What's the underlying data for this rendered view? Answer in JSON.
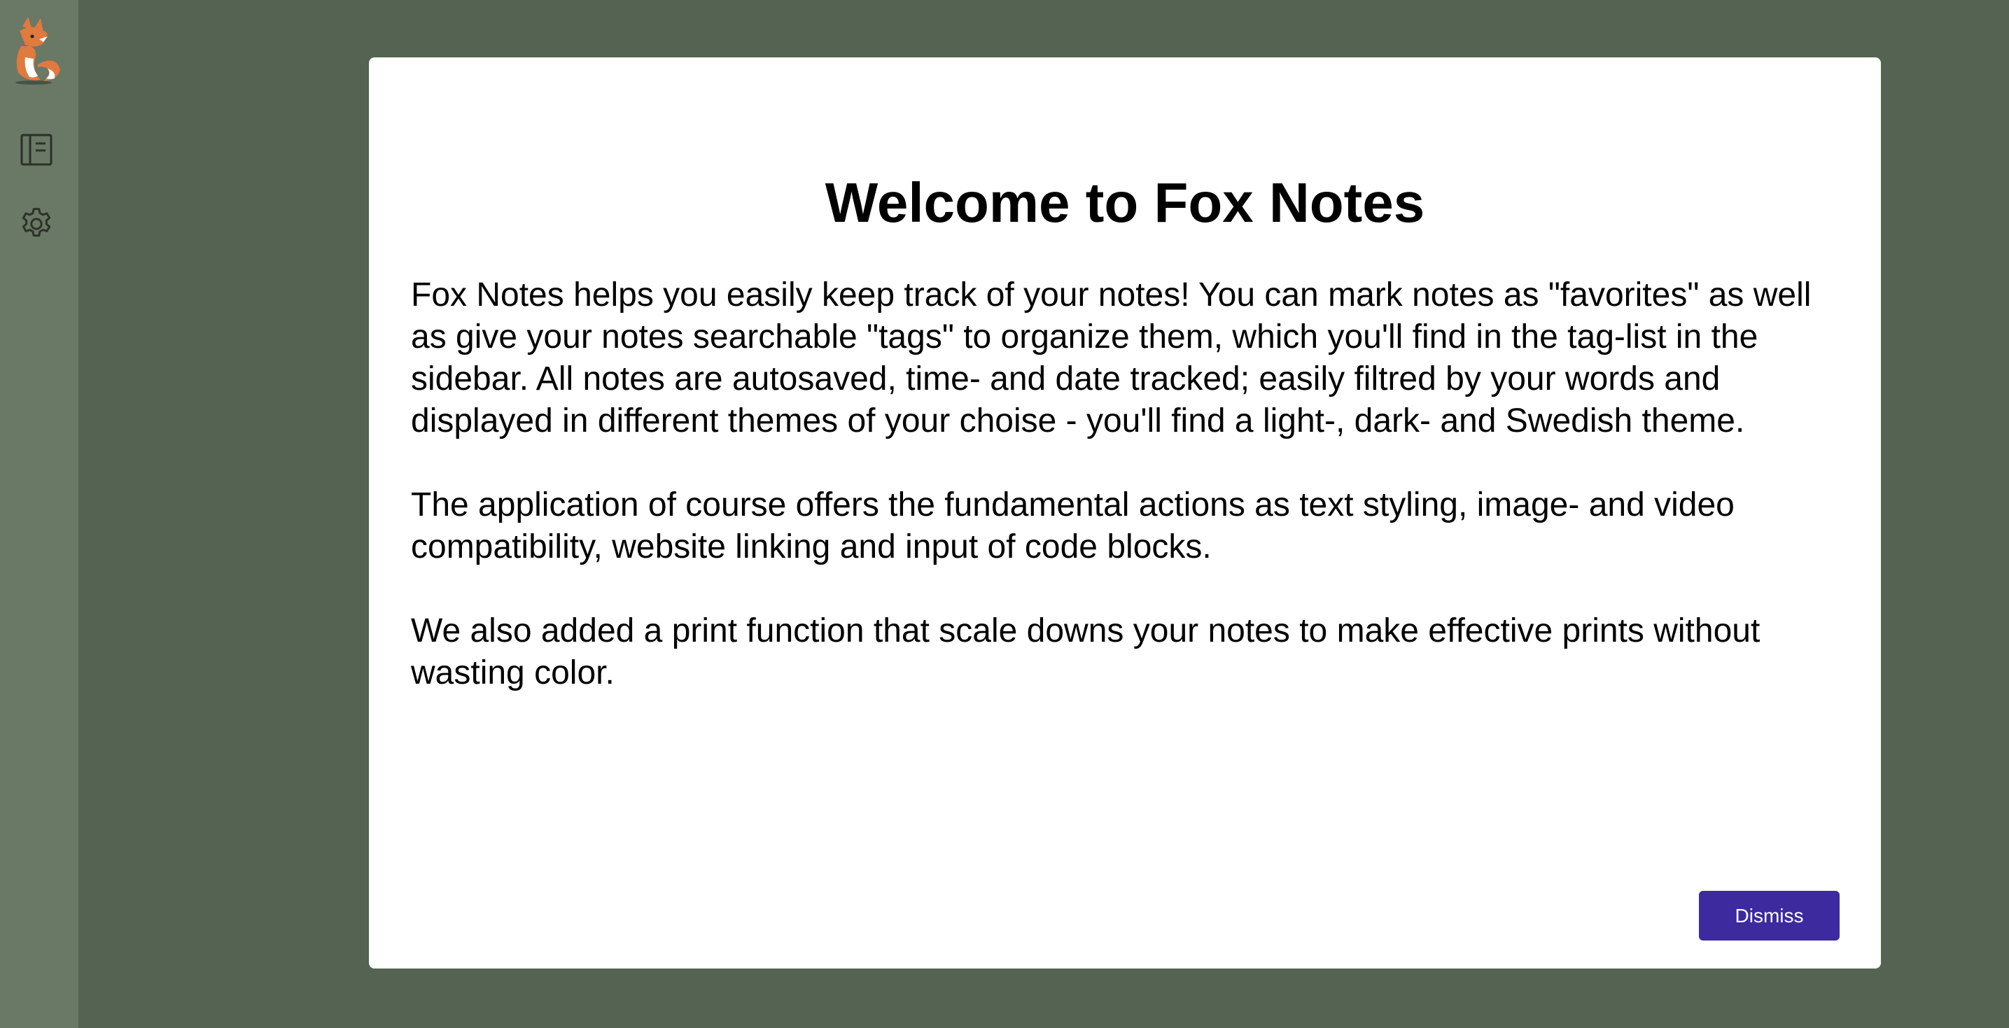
{
  "sidebar": {
    "logo_icon": "fox-logo-icon",
    "items": [
      {
        "icon": "notebook-icon",
        "name": "notes"
      },
      {
        "icon": "gear-icon",
        "name": "settings"
      }
    ]
  },
  "modal": {
    "title": "Welcome to Fox Notes",
    "paragraphs": [
      "Fox Notes helps you easily keep track of your notes! You can mark notes as \"favorites\" as well as give your notes searchable \"tags\" to organize them, which you'll find in the tag-list in the sidebar. All notes are autosaved, time- and date tracked; easily filtred by your words and displayed in different themes of your choise - you'll find a light-, dark- and Swedish theme.",
      "The application of course offers the fundamental actions as text styling, image- and video compatibility, website linking and input of code blocks.",
      "We also added a print function that scale downs your notes to make effective prints without wasting color."
    ],
    "dismiss_label": "Dismiss"
  },
  "colors": {
    "sidebar_bg": "#6a7866",
    "backdrop": "#556352",
    "modal_bg": "#ffffff",
    "button_bg": "#3c2a9e",
    "fox_orange": "#e07a3e"
  }
}
